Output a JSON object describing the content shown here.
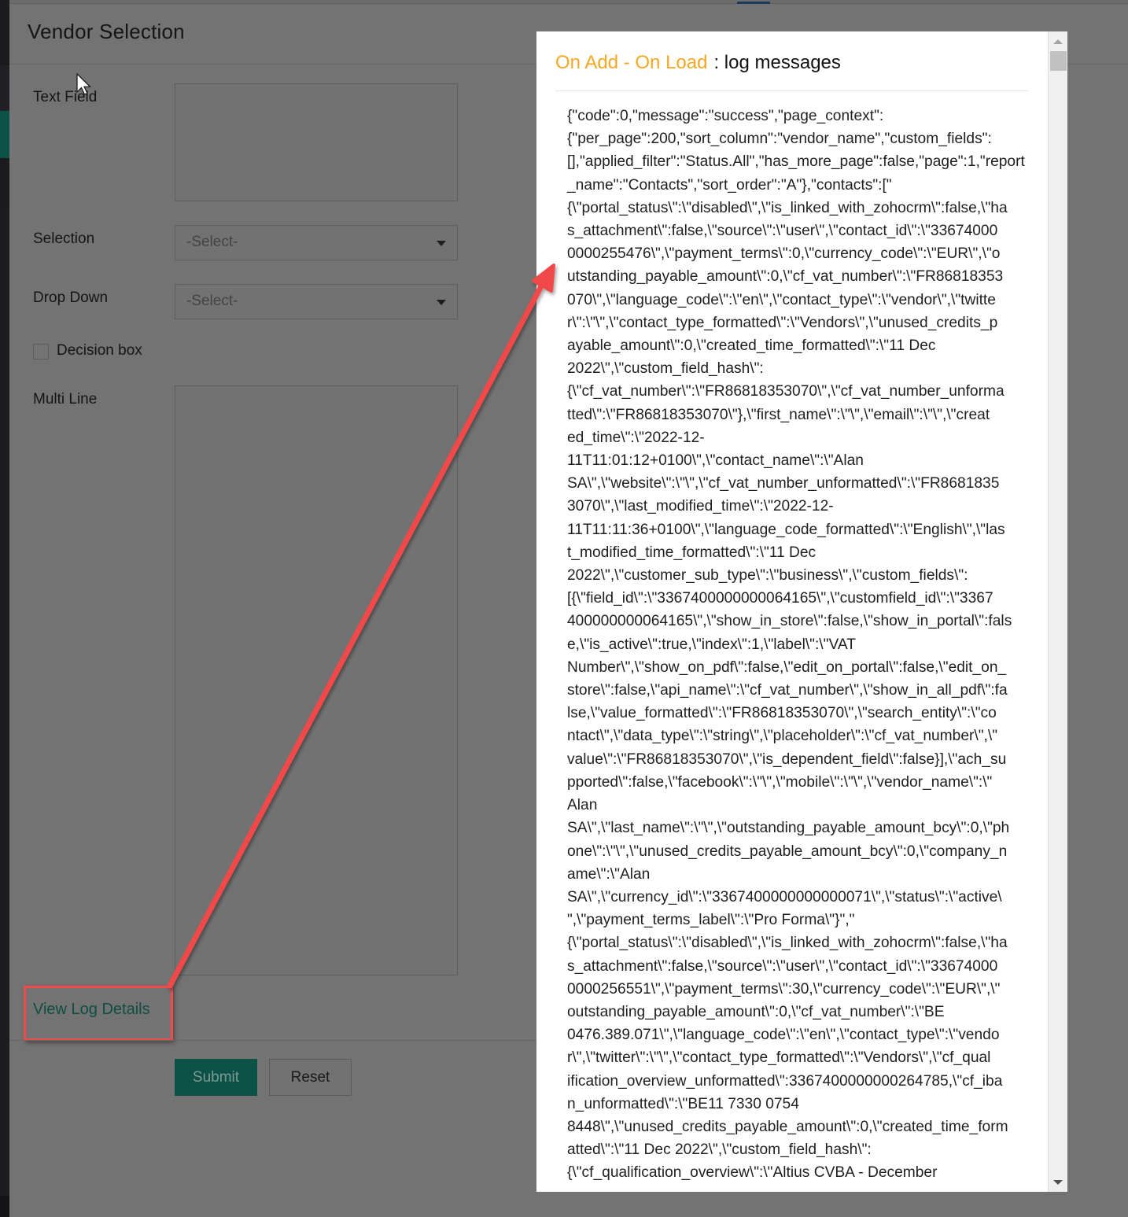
{
  "form": {
    "title": "Vendor Selection",
    "fields": {
      "text_field": {
        "label": "Text Field",
        "value": ""
      },
      "selection": {
        "label": "Selection",
        "selected": "-Select-"
      },
      "drop_down": {
        "label": "Drop Down",
        "selected": "-Select-"
      },
      "decision_box": {
        "label": "Decision box",
        "checked": false
      },
      "multi_line": {
        "label": "Multi Line",
        "value": ""
      }
    },
    "view_log_link": "View Log Details",
    "buttons": {
      "submit": "Submit",
      "reset": "Reset"
    }
  },
  "modal": {
    "event_name": "On Add - On Load",
    "title_suffix": ": log messages",
    "log_lines": [
      "{\"code\":0,\"message\":\"success\",\"page_context\":",
      "{\"per_page\":200,\"sort_column\":\"vendor_name\",\"custom_fields\":",
      "[],\"applied_filter\":\"Status.All\",\"has_more_page\":false,\"page\":1,\"report",
      "_name\":\"Contacts\",\"sort_order\":\"A\"},\"contacts\":[\"",
      "{\\\"portal_status\\\":\\\"disabled\\\",\\\"is_linked_with_zohocrm\\\":false,\\\"ha",
      "s_attachment\\\":false,\\\"source\\\":\\\"user\\\",\\\"contact_id\\\":\\\"33674000",
      "0000255476\\\",\\\"payment_terms\\\":0,\\\"currency_code\\\":\\\"EUR\\\",\\\"o",
      "utstanding_payable_amount\\\":0,\\\"cf_vat_number\\\":\\\"FR86818353",
      "070\\\",\\\"language_code\\\":\\\"en\\\",\\\"contact_type\\\":\\\"vendor\\\",\\\"twitte",
      "r\\\":\\\"\\\",\\\"contact_type_formatted\\\":\\\"Vendors\\\",\\\"unused_credits_p",
      "ayable_amount\\\":0,\\\"created_time_formatted\\\":\\\"11 Dec",
      "2022\\\",\\\"custom_field_hash\\\":",
      "{\\\"cf_vat_number\\\":\\\"FR86818353070\\\",\\\"cf_vat_number_unforma",
      "tted\\\":\\\"FR86818353070\\\"},\\\"first_name\\\":\\\"\\\",\\\"email\\\":\\\"\\\",\\\"creat",
      "ed_time\\\":\\\"2022-12-",
      "11T11:01:12+0100\\\",\\\"contact_name\\\":\\\"Alan",
      "SA\\\",\\\"website\\\":\\\"\\\",\\\"cf_vat_number_unformatted\\\":\\\"FR8681835",
      "3070\\\",\\\"last_modified_time\\\":\\\"2022-12-",
      "11T11:11:36+0100\\\",\\\"language_code_formatted\\\":\\\"English\\\",\\\"las",
      "t_modified_time_formatted\\\":\\\"11 Dec",
      "2022\\\",\\\"customer_sub_type\\\":\\\"business\\\",\\\"custom_fields\\\":",
      "[{\\\"field_id\\\":\\\"3367400000000064165\\\",\\\"customfield_id\\\":\\\"3367",
      "400000000064165\\\",\\\"show_in_store\\\":false,\\\"show_in_portal\\\":fals",
      "e,\\\"is_active\\\":true,\\\"index\\\":1,\\\"label\\\":\\\"VAT",
      "Number\\\",\\\"show_on_pdf\\\":false,\\\"edit_on_portal\\\":false,\\\"edit_on_",
      "store\\\":false,\\\"api_name\\\":\\\"cf_vat_number\\\",\\\"show_in_all_pdf\\\":fa",
      "lse,\\\"value_formatted\\\":\\\"FR86818353070\\\",\\\"search_entity\\\":\\\"co",
      "ntact\\\",\\\"data_type\\\":\\\"string\\\",\\\"placeholder\\\":\\\"cf_vat_number\\\",\\\"",
      "value\\\":\\\"FR86818353070\\\",\\\"is_dependent_field\\\":false}],\\\"ach_su",
      "pported\\\":false,\\\"facebook\\\":\\\"\\\",\\\"mobile\\\":\\\"\\\",\\\"vendor_name\\\":\\\"",
      "Alan",
      "SA\\\",\\\"last_name\\\":\\\"\\\",\\\"outstanding_payable_amount_bcy\\\":0,\\\"ph",
      "one\\\":\\\"\\\",\\\"unused_credits_payable_amount_bcy\\\":0,\\\"company_n",
      "ame\\\":\\\"Alan",
      "SA\\\",\\\"currency_id\\\":\\\"3367400000000000071\\\",\\\"status\\\":\\\"active\\",
      "\",\\\"payment_terms_label\\\":\\\"Pro Forma\\\"}\",\"",
      "{\\\"portal_status\\\":\\\"disabled\\\",\\\"is_linked_with_zohocrm\\\":false,\\\"ha",
      "s_attachment\\\":false,\\\"source\\\":\\\"user\\\",\\\"contact_id\\\":\\\"33674000",
      "0000256551\\\",\\\"payment_terms\\\":30,\\\"currency_code\\\":\\\"EUR\\\",\\\"",
      "outstanding_payable_amount\\\":0,\\\"cf_vat_number\\\":\\\"BE",
      "0476.389.071\\\",\\\"language_code\\\":\\\"en\\\",\\\"contact_type\\\":\\\"vendo",
      "r\\\",\\\"twitter\\\":\\\"\\\",\\\"contact_type_formatted\\\":\\\"Vendors\\\",\\\"cf_qual",
      "ification_overview_unformatted\\\":3367400000000264785,\\\"cf_iba",
      "n_unformatted\\\":\\\"BE11 7330 0754",
      "8448\\\",\\\"unused_credits_payable_amount\\\":0,\\\"created_time_form",
      "atted\\\":\\\"11 Dec 2022\\\",\\\"custom_field_hash\\\":",
      "{\\\"cf_qualification_overview\\\":\\\"Altius CVBA - December"
    ]
  },
  "colors": {
    "overlay_bg": "#737373",
    "brand_green": "#0c5146",
    "event_orange": "#f5a623",
    "annotation_red": "#f14a4a"
  },
  "icons": {
    "select_caret": "caret-down-icon",
    "scroll_up": "scroll-up-arrow-icon",
    "scroll_down": "scroll-down-arrow-icon",
    "cursor": "mouse-pointer-icon",
    "annotation": "red-arrow-annotation"
  }
}
